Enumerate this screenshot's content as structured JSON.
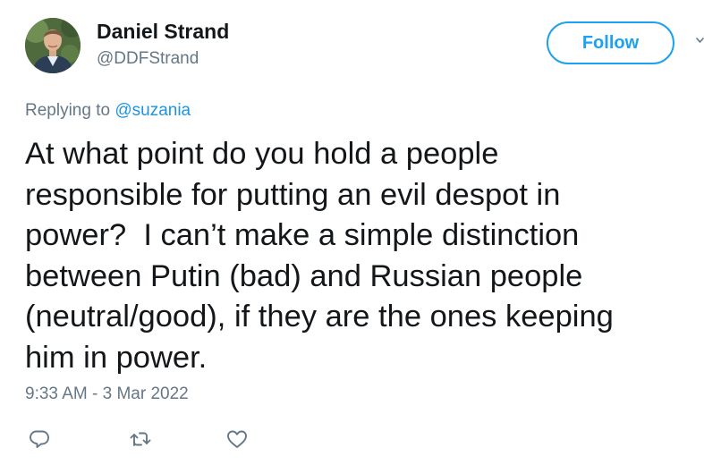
{
  "author": {
    "display_name": "Daniel Strand",
    "handle": "@DDFStrand"
  },
  "follow_button": {
    "label": "Follow"
  },
  "reply_context": {
    "prefix": "Replying to ",
    "mention": "@suzania"
  },
  "tweet": {
    "text": "At what point do you hold a people\nresponsible for putting an evil despot in\npower?  I can’t make a simple distinction\nbetween Putin (bad) and Russian people\n(neutral/good), if they are the ones keeping\nhim in power.",
    "timestamp": "9:33 AM - 3 Mar 2022"
  },
  "actions": {
    "icons": [
      "reply-icon",
      "retweet-icon",
      "like-icon"
    ]
  },
  "colors": {
    "accent": "#1da1f2",
    "link": "#1b95e0",
    "secondary_text": "#657786",
    "primary_text": "#14171a",
    "icon": "#657786"
  }
}
